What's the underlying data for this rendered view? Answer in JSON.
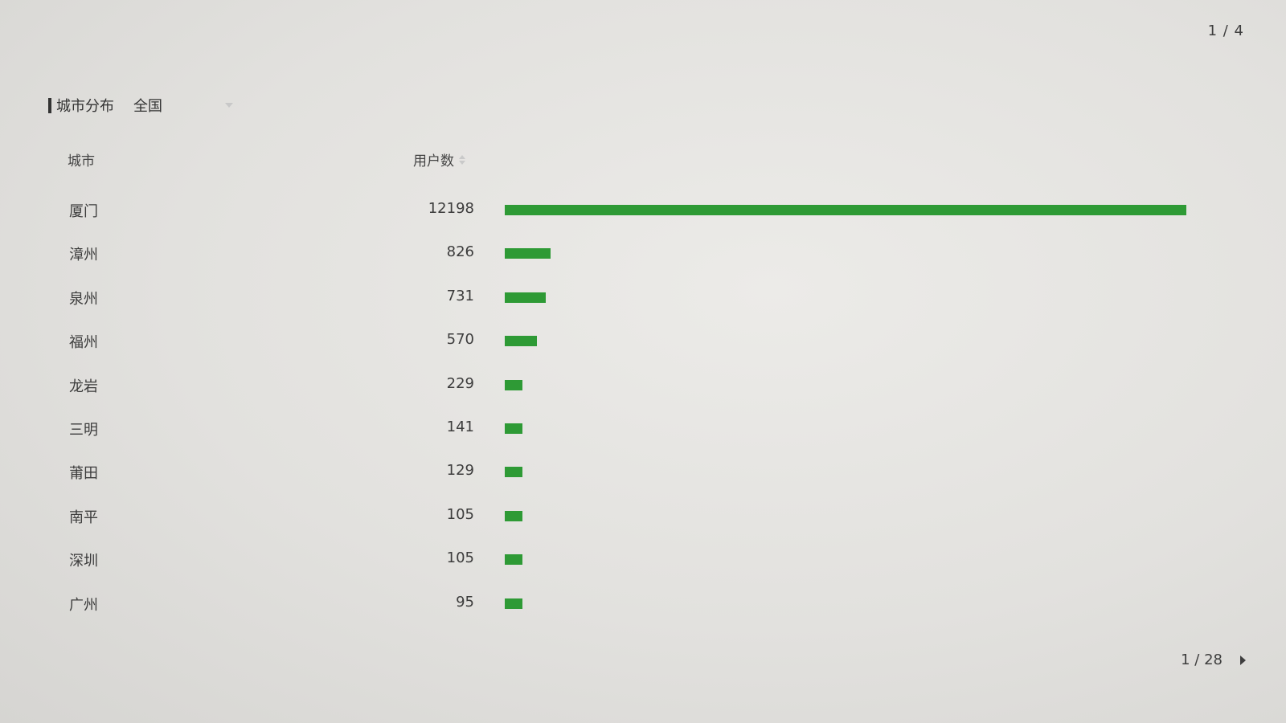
{
  "top_page_indicator": "1 / 4",
  "header": {
    "title": "城市分布",
    "region": "全国"
  },
  "table": {
    "columns": {
      "city": "城市",
      "users": "用户数"
    },
    "rows": [
      {
        "city": "厦门",
        "users": "12198",
        "value": 12198
      },
      {
        "city": "漳州",
        "users": "826",
        "value": 826
      },
      {
        "city": "泉州",
        "users": "731",
        "value": 731
      },
      {
        "city": "福州",
        "users": "570",
        "value": 570
      },
      {
        "city": "龙岩",
        "users": "229",
        "value": 229
      },
      {
        "city": "三明",
        "users": "141",
        "value": 141
      },
      {
        "city": "莆田",
        "users": "129",
        "value": 129
      },
      {
        "city": "南平",
        "users": "105",
        "value": 105
      },
      {
        "city": "深圳",
        "users": "105",
        "value": 105
      },
      {
        "city": "广州",
        "users": "95",
        "value": 95
      }
    ]
  },
  "pagination": {
    "label": "1 / 28"
  },
  "colors": {
    "bar": "#2e9a35"
  }
}
